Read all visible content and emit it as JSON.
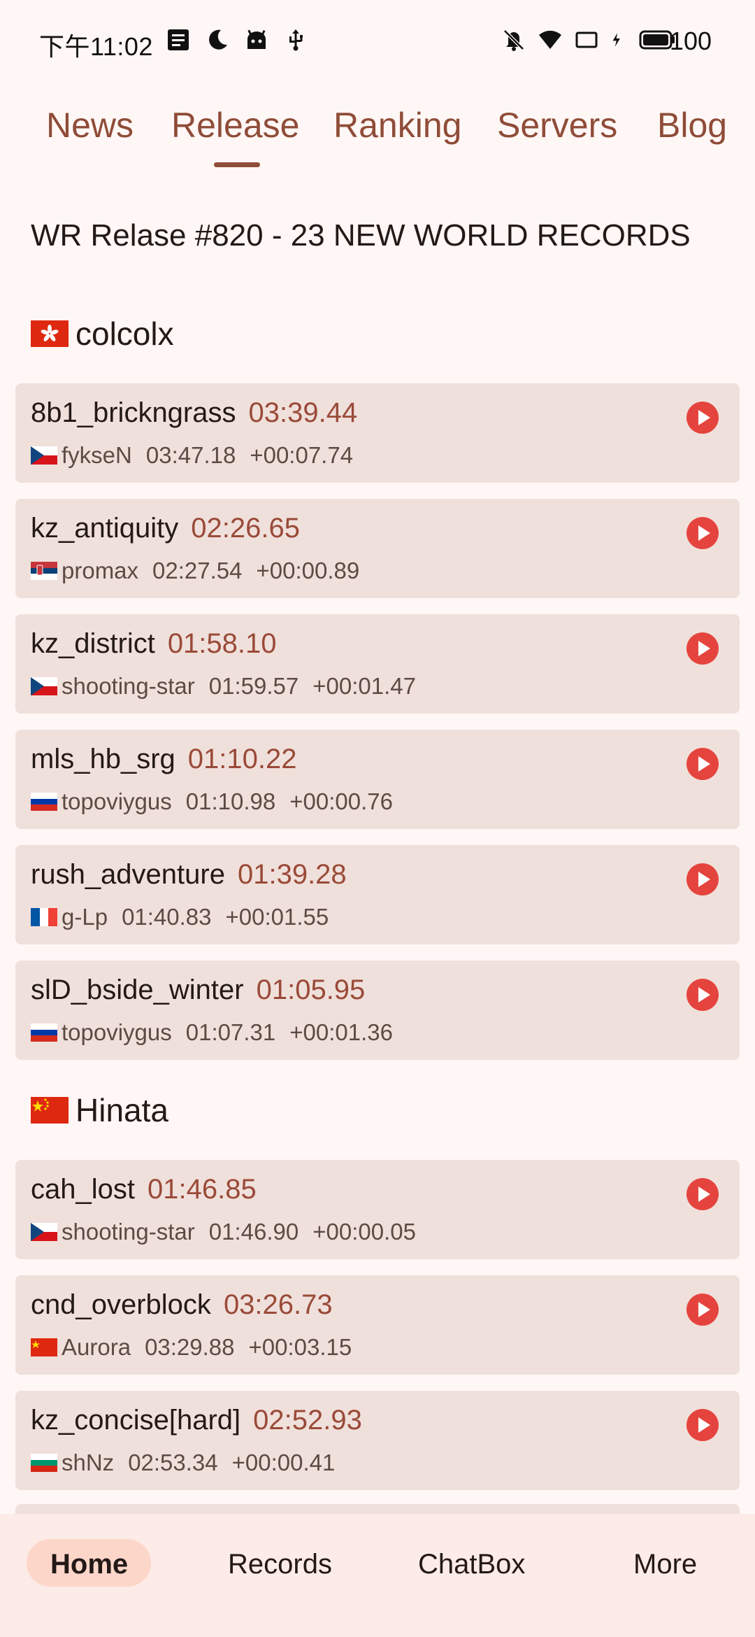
{
  "status_bar": {
    "time": "下午11:02",
    "battery": "100",
    "left_icons": [
      "notes-icon",
      "moon-icon",
      "android-icon",
      "usb-icon"
    ],
    "right_icons": [
      "mute-icon",
      "wifi-icon",
      "screen-icon",
      "charging-icon",
      "battery-icon"
    ]
  },
  "tabs": [
    {
      "label": "News",
      "selected": false
    },
    {
      "label": "Release",
      "selected": true
    },
    {
      "label": "Ranking",
      "selected": false
    },
    {
      "label": "Servers",
      "selected": false
    },
    {
      "label": "Blog",
      "selected": false
    }
  ],
  "release_title": "WR Relase #820 - 23 NEW WORLD RECORDS",
  "sections": [
    {
      "player": "colcolx",
      "flag": "hk",
      "records": [
        {
          "map": "8b1_brickngrass",
          "time": "03:39.44",
          "prev_flag": "cz",
          "prev_player": "fykseN",
          "prev_time": "03:47.18",
          "diff": "+00:07.74"
        },
        {
          "map": "kz_antiquity",
          "time": "02:26.65",
          "prev_flag": "rs",
          "prev_player": "promax",
          "prev_time": "02:27.54",
          "diff": "+00:00.89"
        },
        {
          "map": "kz_district",
          "time": "01:58.10",
          "prev_flag": "cz",
          "prev_player": "shooting-star",
          "prev_time": "01:59.57",
          "diff": "+00:01.47"
        },
        {
          "map": "mls_hb_srg",
          "time": "01:10.22",
          "prev_flag": "ru",
          "prev_player": "topoviygus",
          "prev_time": "01:10.98",
          "diff": "+00:00.76"
        },
        {
          "map": "rush_adventure",
          "time": "01:39.28",
          "prev_flag": "fr",
          "prev_player": "g-Lp",
          "prev_time": "01:40.83",
          "diff": "+00:01.55"
        },
        {
          "map": "slD_bside_winter",
          "time": "01:05.95",
          "prev_flag": "ru",
          "prev_player": "topoviygus",
          "prev_time": "01:07.31",
          "diff": "+00:01.36"
        }
      ]
    },
    {
      "player": "Hinata",
      "flag": "cn",
      "records": [
        {
          "map": "cah_lost",
          "time": "01:46.85",
          "prev_flag": "cz",
          "prev_player": "shooting-star",
          "prev_time": "01:46.90",
          "diff": "+00:00.05"
        },
        {
          "map": "cnd_overblock",
          "time": "03:26.73",
          "prev_flag": "cn",
          "prev_player": "Aurora",
          "prev_time": "03:29.88",
          "diff": "+00:03.15"
        },
        {
          "map": "kz_concise[hard]",
          "time": "02:52.93",
          "prev_flag": "bg",
          "prev_player": "shNz",
          "prev_time": "02:53.34",
          "diff": "+00:00.41"
        }
      ]
    }
  ],
  "bottom_nav": [
    {
      "label": "Home",
      "selected": true
    },
    {
      "label": "Records",
      "selected": false
    },
    {
      "label": "ChatBox",
      "selected": false
    },
    {
      "label": "More",
      "selected": false
    }
  ],
  "colors": {
    "accent": "#8f4c38",
    "wr_time": "#9a4a38",
    "card_bg": "#f0e0db",
    "play_button": "#e5443e",
    "background": "#fff7f5",
    "nav_bg": "#fcebe6",
    "nav_active_pill": "#fdd6ca"
  }
}
